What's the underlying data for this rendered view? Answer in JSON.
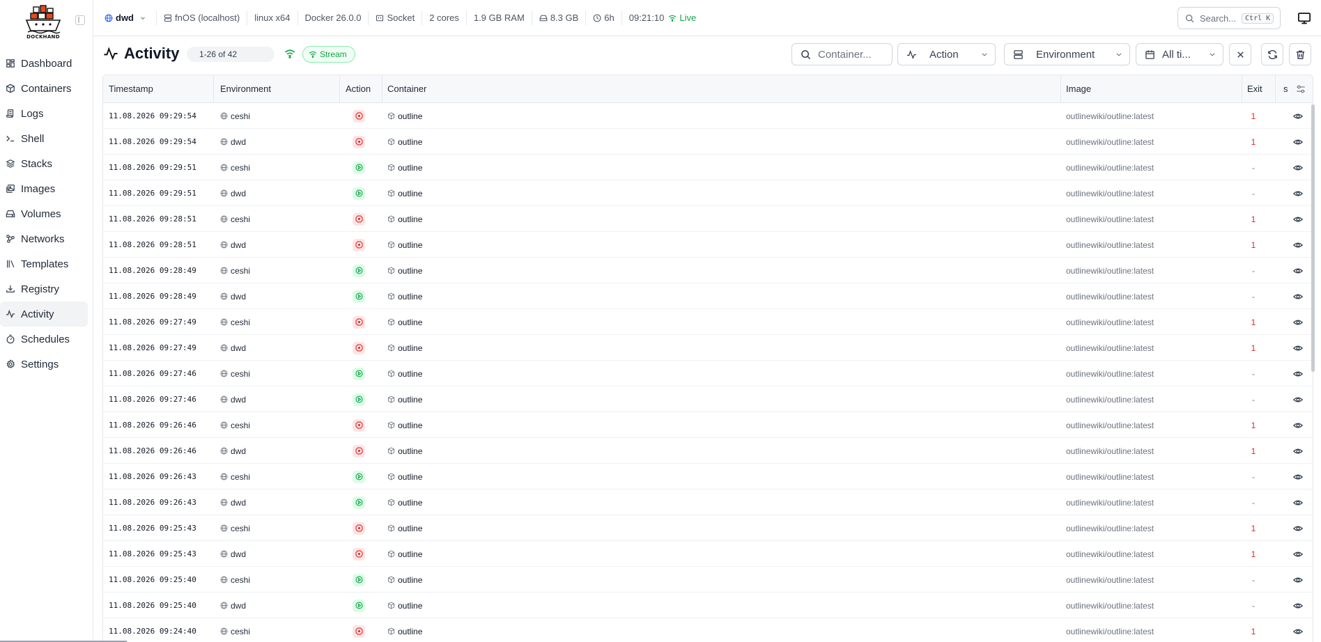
{
  "app": {
    "logo_text": "DOCKHAND"
  },
  "sidebar": {
    "items": [
      {
        "label": "Dashboard",
        "icon": "dashboard-icon",
        "active": false
      },
      {
        "label": "Containers",
        "icon": "box-icon",
        "active": false
      },
      {
        "label": "Logs",
        "icon": "scroll-icon",
        "active": false
      },
      {
        "label": "Shell",
        "icon": "terminal-icon",
        "active": false
      },
      {
        "label": "Stacks",
        "icon": "layers-icon",
        "active": false
      },
      {
        "label": "Images",
        "icon": "images-icon",
        "active": false
      },
      {
        "label": "Volumes",
        "icon": "hard-drive-icon",
        "active": false
      },
      {
        "label": "Networks",
        "icon": "network-icon",
        "active": false
      },
      {
        "label": "Templates",
        "icon": "library-icon",
        "active": false
      },
      {
        "label": "Registry",
        "icon": "download-icon",
        "active": false
      },
      {
        "label": "Activity",
        "icon": "activity-icon",
        "active": true
      },
      {
        "label": "Schedules",
        "icon": "timer-icon",
        "active": false
      },
      {
        "label": "Settings",
        "icon": "gear-icon",
        "active": false
      }
    ]
  },
  "topbar": {
    "environment": "dwd",
    "host": "fnOS (localhost)",
    "platform": "linux x64",
    "docker": "Docker 26.0.0",
    "connection": "Socket",
    "cores": "2 cores",
    "ram": "1.9 GB RAM",
    "disk": "8.3 GB",
    "uptime": "6h",
    "time": "09:21:10",
    "live": "Live",
    "search_label": "Search...",
    "search_kbd": "Ctrl K"
  },
  "page": {
    "title": "Activity",
    "count": "1-26 of 42",
    "stream": "Stream",
    "filters": {
      "container_placeholder": "Container...",
      "action": "Action",
      "environment": "Environment",
      "time": "All ti..."
    }
  },
  "table": {
    "headers": {
      "timestamp": "Timestamp",
      "environment": "Environment",
      "action": "Action",
      "container": "Container",
      "image": "Image",
      "exit": "Exit",
      "s": "s"
    },
    "rows": [
      {
        "timestamp": "11.08.2026 09:29:54",
        "environment": "ceshi",
        "action": "stop",
        "container": "outline",
        "image": "outlinewiki/outline:latest",
        "exit": "1"
      },
      {
        "timestamp": "11.08.2026 09:29:54",
        "environment": "dwd",
        "action": "stop",
        "container": "outline",
        "image": "outlinewiki/outline:latest",
        "exit": "1"
      },
      {
        "timestamp": "11.08.2026 09:29:51",
        "environment": "ceshi",
        "action": "start",
        "container": "outline",
        "image": "outlinewiki/outline:latest",
        "exit": "-"
      },
      {
        "timestamp": "11.08.2026 09:29:51",
        "environment": "dwd",
        "action": "start",
        "container": "outline",
        "image": "outlinewiki/outline:latest",
        "exit": "-"
      },
      {
        "timestamp": "11.08.2026 09:28:51",
        "environment": "ceshi",
        "action": "stop",
        "container": "outline",
        "image": "outlinewiki/outline:latest",
        "exit": "1"
      },
      {
        "timestamp": "11.08.2026 09:28:51",
        "environment": "dwd",
        "action": "stop",
        "container": "outline",
        "image": "outlinewiki/outline:latest",
        "exit": "1"
      },
      {
        "timestamp": "11.08.2026 09:28:49",
        "environment": "ceshi",
        "action": "start",
        "container": "outline",
        "image": "outlinewiki/outline:latest",
        "exit": "-"
      },
      {
        "timestamp": "11.08.2026 09:28:49",
        "environment": "dwd",
        "action": "start",
        "container": "outline",
        "image": "outlinewiki/outline:latest",
        "exit": "-"
      },
      {
        "timestamp": "11.08.2026 09:27:49",
        "environment": "ceshi",
        "action": "stop",
        "container": "outline",
        "image": "outlinewiki/outline:latest",
        "exit": "1"
      },
      {
        "timestamp": "11.08.2026 09:27:49",
        "environment": "dwd",
        "action": "stop",
        "container": "outline",
        "image": "outlinewiki/outline:latest",
        "exit": "1"
      },
      {
        "timestamp": "11.08.2026 09:27:46",
        "environment": "ceshi",
        "action": "start",
        "container": "outline",
        "image": "outlinewiki/outline:latest",
        "exit": "-"
      },
      {
        "timestamp": "11.08.2026 09:27:46",
        "environment": "dwd",
        "action": "start",
        "container": "outline",
        "image": "outlinewiki/outline:latest",
        "exit": "-"
      },
      {
        "timestamp": "11.08.2026 09:26:46",
        "environment": "ceshi",
        "action": "stop",
        "container": "outline",
        "image": "outlinewiki/outline:latest",
        "exit": "1"
      },
      {
        "timestamp": "11.08.2026 09:26:46",
        "environment": "dwd",
        "action": "stop",
        "container": "outline",
        "image": "outlinewiki/outline:latest",
        "exit": "1"
      },
      {
        "timestamp": "11.08.2026 09:26:43",
        "environment": "ceshi",
        "action": "start",
        "container": "outline",
        "image": "outlinewiki/outline:latest",
        "exit": "-"
      },
      {
        "timestamp": "11.08.2026 09:26:43",
        "environment": "dwd",
        "action": "start",
        "container": "outline",
        "image": "outlinewiki/outline:latest",
        "exit": "-"
      },
      {
        "timestamp": "11.08.2026 09:25:43",
        "environment": "ceshi",
        "action": "stop",
        "container": "outline",
        "image": "outlinewiki/outline:latest",
        "exit": "1"
      },
      {
        "timestamp": "11.08.2026 09:25:43",
        "environment": "dwd",
        "action": "stop",
        "container": "outline",
        "image": "outlinewiki/outline:latest",
        "exit": "1"
      },
      {
        "timestamp": "11.08.2026 09:25:40",
        "environment": "ceshi",
        "action": "start",
        "container": "outline",
        "image": "outlinewiki/outline:latest",
        "exit": "-"
      },
      {
        "timestamp": "11.08.2026 09:25:40",
        "environment": "dwd",
        "action": "start",
        "container": "outline",
        "image": "outlinewiki/outline:latest",
        "exit": "-"
      },
      {
        "timestamp": "11.08.2026 09:24:40",
        "environment": "ceshi",
        "action": "stop",
        "container": "outline",
        "image": "outlinewiki/outline:latest",
        "exit": "1"
      }
    ]
  },
  "colors": {
    "accent_green": "#16a34a",
    "error_red": "#dc2626",
    "border": "#e5e7eb"
  }
}
